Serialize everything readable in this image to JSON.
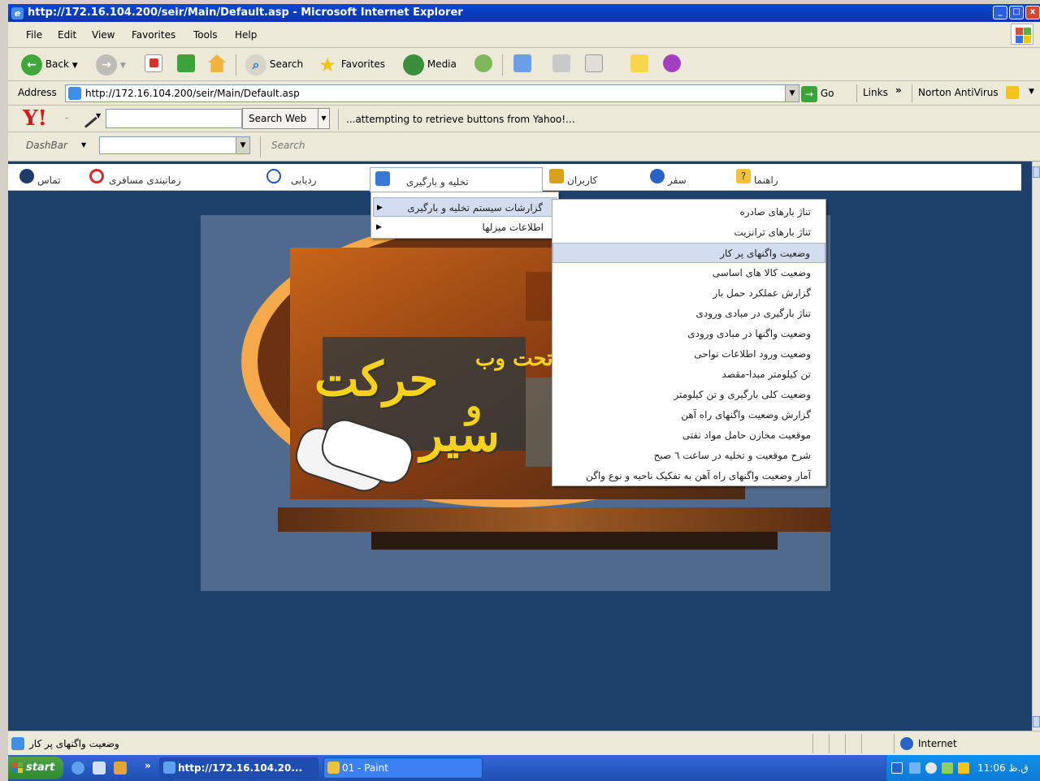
{
  "window": {
    "title": "http://172.16.104.200/seir/Main/Default.asp - Microsoft Internet Explorer",
    "controls": [
      "_",
      "□",
      "x"
    ]
  },
  "menubar": {
    "items": [
      "File",
      "Edit",
      "View",
      "Favorites",
      "Tools",
      "Help"
    ]
  },
  "toolbar": {
    "back_label": "Back",
    "search_label": "Search",
    "favorites_label": "Favorites",
    "media_label": "Media"
  },
  "address": {
    "label": "Address",
    "url": "http://172.16.104.200/seir/Main/Default.asp",
    "go_label": "Go",
    "links_label": "Links",
    "norton_label": "Norton AntiVirus"
  },
  "yahoo": {
    "logo": "Y!",
    "search_value": "",
    "search_button": "Search Web",
    "status_text": "...attempting to retrieve buttons from Yahoo!..."
  },
  "dashbar": {
    "label": "DashBar",
    "input_value": "",
    "search_label": "Search"
  },
  "nav": {
    "items": [
      {
        "label": "تماس"
      },
      {
        "label": "زمانبندی مسافری"
      },
      {
        "label": "ردیابی"
      },
      {
        "label": "تخلیه و بارگیری"
      },
      {
        "label": "کاربران"
      },
      {
        "label": "سفر"
      },
      {
        "label": "راهنما"
      }
    ]
  },
  "banner": {
    "title_line1": "حرکت",
    "title_line2": "سیر",
    "title_connector": "و",
    "web_text": "تحت وب"
  },
  "submenu1": {
    "items": [
      {
        "label": "گزارشات سیستم تخلیه و بارگیری"
      },
      {
        "label": "اطلاعات میزلها"
      }
    ]
  },
  "submenu2": {
    "items": [
      {
        "label": "تناژ بارهای صادره"
      },
      {
        "label": "تناژ بارهای ترانزیت"
      },
      {
        "label": "وضعیت واگنهای پر کار"
      },
      {
        "label": "وضعیت کالا های اساسی"
      },
      {
        "label": "گزارش عملکرد حمل بار"
      },
      {
        "label": "تناژ بارگیری در مبادی ورودی"
      },
      {
        "label": "وضعیت واگنها در مبادی ورودی"
      },
      {
        "label": "وضعیت ورود اطلاعات نواحی"
      },
      {
        "label": "تن کیلومتر مبدا-مقصد"
      },
      {
        "label": "وضعیت کلی بارگیری و تن کیلومتر"
      },
      {
        "label": "گزارش وضعیت واگنهای راه آهن"
      },
      {
        "label": "موقعیت مخازن حامل مواد نفتی"
      },
      {
        "label": "شرح موقعیت و تخلیه در ساعت ٦ صبح"
      },
      {
        "label": "آمار وضعیت واگنهای راه آهن به تفکیک ناحیه و نوع واگن"
      }
    ],
    "highlighted_index": 2
  },
  "status": {
    "text": "وضعیت واگنهای پر کار",
    "zone": "Internet"
  },
  "taskbar": {
    "start_label": "start",
    "buttons": [
      {
        "label": "http://172.16.104.20..."
      },
      {
        "label": "01 - Paint"
      }
    ],
    "chevron": "»",
    "clock": "11:06 ق.ظ"
  },
  "colors": {
    "content_bg": "#1e416b",
    "panel_bg": "#4f6a8c",
    "menu_highlight": "#d4dcf0",
    "banner_yellow": "#f7d21c"
  }
}
